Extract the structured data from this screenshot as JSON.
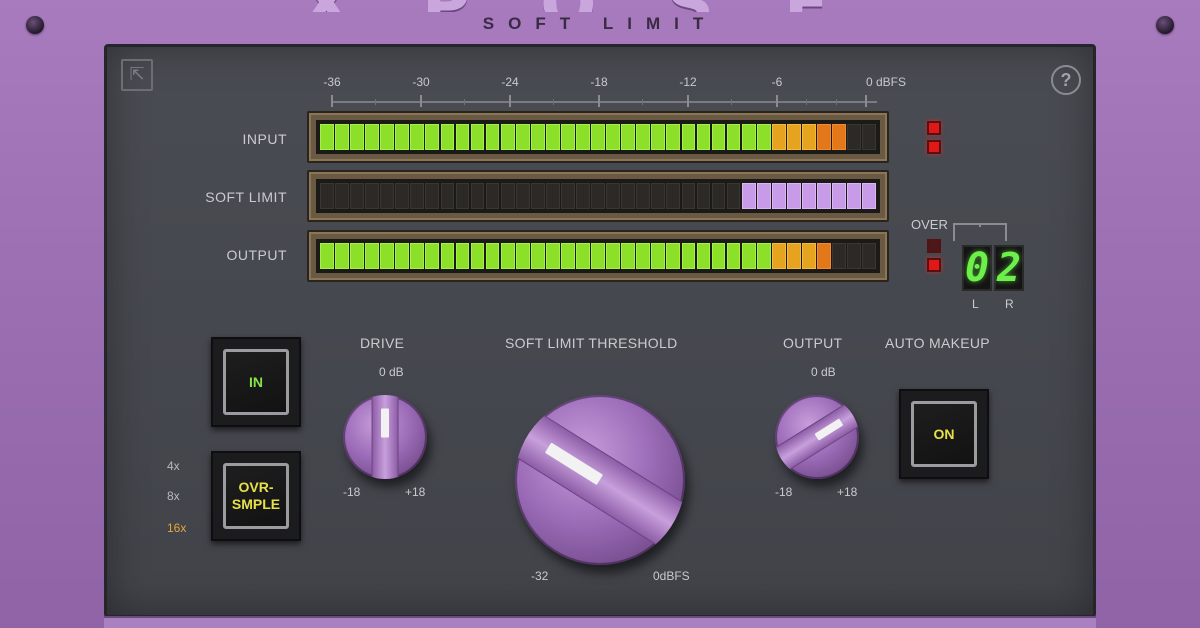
{
  "header": {
    "logo_fragment": "XPOSE",
    "subtitle": "SOFT LIMIT"
  },
  "toolbar": {
    "resize_icon": "resize-icon",
    "help_icon": "help-icon",
    "help_glyph": "?"
  },
  "scale": {
    "labels": [
      "-36",
      "-30",
      "-24",
      "-18",
      "-12",
      "-6",
      "0 dBFS"
    ]
  },
  "meters": {
    "input": {
      "label": "INPUT"
    },
    "soft_limit": {
      "label": "SOFT LIMIT"
    },
    "output": {
      "label": "OUTPUT"
    }
  },
  "over": {
    "label": "OVER",
    "left_digit": "0",
    "right_digit": "2",
    "left_label": "L",
    "right_label": "R"
  },
  "buttons": {
    "in": {
      "label": "IN"
    },
    "oversample": {
      "label_line1": "OVR-",
      "label_line2": "SMPLE",
      "options": [
        "4x",
        "8x",
        "16x"
      ],
      "selected": "16x"
    },
    "auto_makeup": {
      "label": "AUTO MAKEUP",
      "button_label": "ON"
    }
  },
  "knobs": {
    "drive": {
      "label": "DRIVE",
      "top": "0 dB",
      "min": "-18",
      "max": "+18"
    },
    "threshold": {
      "label": "SOFT LIMIT THRESHOLD",
      "min": "-32",
      "max": "0dBFS"
    },
    "output": {
      "label": "OUTPUT",
      "top": "0 dB",
      "min": "-18",
      "max": "+18"
    }
  },
  "colors": {
    "accent_purple": "#a77bbd",
    "meter_green": "#8ce02a",
    "meter_orange": "#e2781a",
    "meter_purple": "#c89be8",
    "led_red": "#e01818"
  }
}
